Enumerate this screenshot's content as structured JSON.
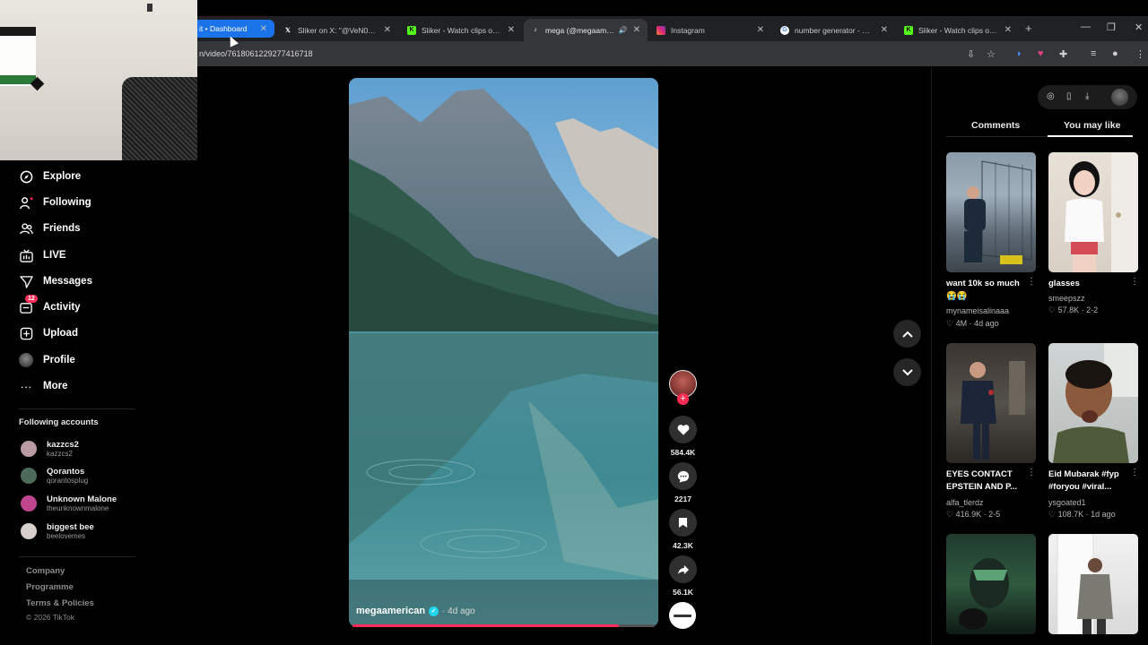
{
  "browser": {
    "tabs": [
      {
        "title": "it • Dashboard",
        "favicon": "none"
      },
      {
        "title": "Sliker on X: \"@VeN0_E @...",
        "favicon": "x-logo-icon"
      },
      {
        "title": "Sliker - Watch clips on Kick",
        "favicon": "kick-icon"
      },
      {
        "title": "mega (@megaamerican...",
        "favicon": "tiktok-icon",
        "audio": true
      },
      {
        "title": "Instagram",
        "favicon": "instagram-icon"
      },
      {
        "title": "number generator - Google",
        "favicon": "google-icon"
      },
      {
        "title": "Sliker - Watch clips on Kick",
        "favicon": "kick-icon"
      }
    ],
    "url": "n/video/7618061229277416718"
  },
  "sidebar": {
    "items": [
      {
        "label": "Explore",
        "icon": "compass-icon"
      },
      {
        "label": "Following",
        "icon": "following-icon"
      },
      {
        "label": "Friends",
        "icon": "friends-icon"
      },
      {
        "label": "LIVE",
        "icon": "live-icon"
      },
      {
        "label": "Messages",
        "icon": "messages-icon"
      },
      {
        "label": "Activity",
        "icon": "activity-icon",
        "badge": "12"
      },
      {
        "label": "Upload",
        "icon": "upload-icon"
      },
      {
        "label": "Profile",
        "icon": "profile-avatar"
      },
      {
        "label": "More",
        "icon": "more-icon"
      }
    ],
    "following_title": "Following accounts",
    "accounts": [
      {
        "name": "kazzcs2",
        "handle": "kazzcs2",
        "color": "#b89aa0"
      },
      {
        "name": "Qorantos",
        "handle": "qorantosplug",
        "color": "#4e6a5a"
      },
      {
        "name": "Unknown Malone",
        "handle": "theunknownmalone",
        "color": "#c0458f"
      },
      {
        "name": "biggest bee",
        "handle": "beelovemes",
        "color": "#d7cfcb"
      }
    ],
    "footer": {
      "company": "Company",
      "programme": "Programme",
      "terms": "Terms & Policies",
      "copyright": "© 2026 TikTok"
    }
  },
  "video": {
    "username": "megaamerican",
    "date": "· 4d ago",
    "progress": 0.88,
    "likes": "584.4K",
    "comments": "2217",
    "saves": "42.3K",
    "shares": "56.1K"
  },
  "right_panel": {
    "tabs": [
      "Comments",
      "You may like"
    ],
    "active_tab": "You may like",
    "cards": [
      {
        "title": "want 10k so much 😭😭",
        "user": "mynameisalinaaa",
        "meta": "4M · 4d ago"
      },
      {
        "title": "glasses",
        "user": "smeepszz",
        "meta": "57.8K · 2-2"
      },
      {
        "title": "EYES CONTACT EPSTEIN AND P...",
        "user": "alfa_tlerdz",
        "meta": "416.9K · 2-5"
      },
      {
        "title": "Eid Mubarak #fyp #foryou #viral...",
        "user": "ysgoated1",
        "meta": "108.7K · 1d ago"
      }
    ]
  },
  "colors": {
    "accent": "#fe2c55",
    "verified": "#20d5ec"
  }
}
